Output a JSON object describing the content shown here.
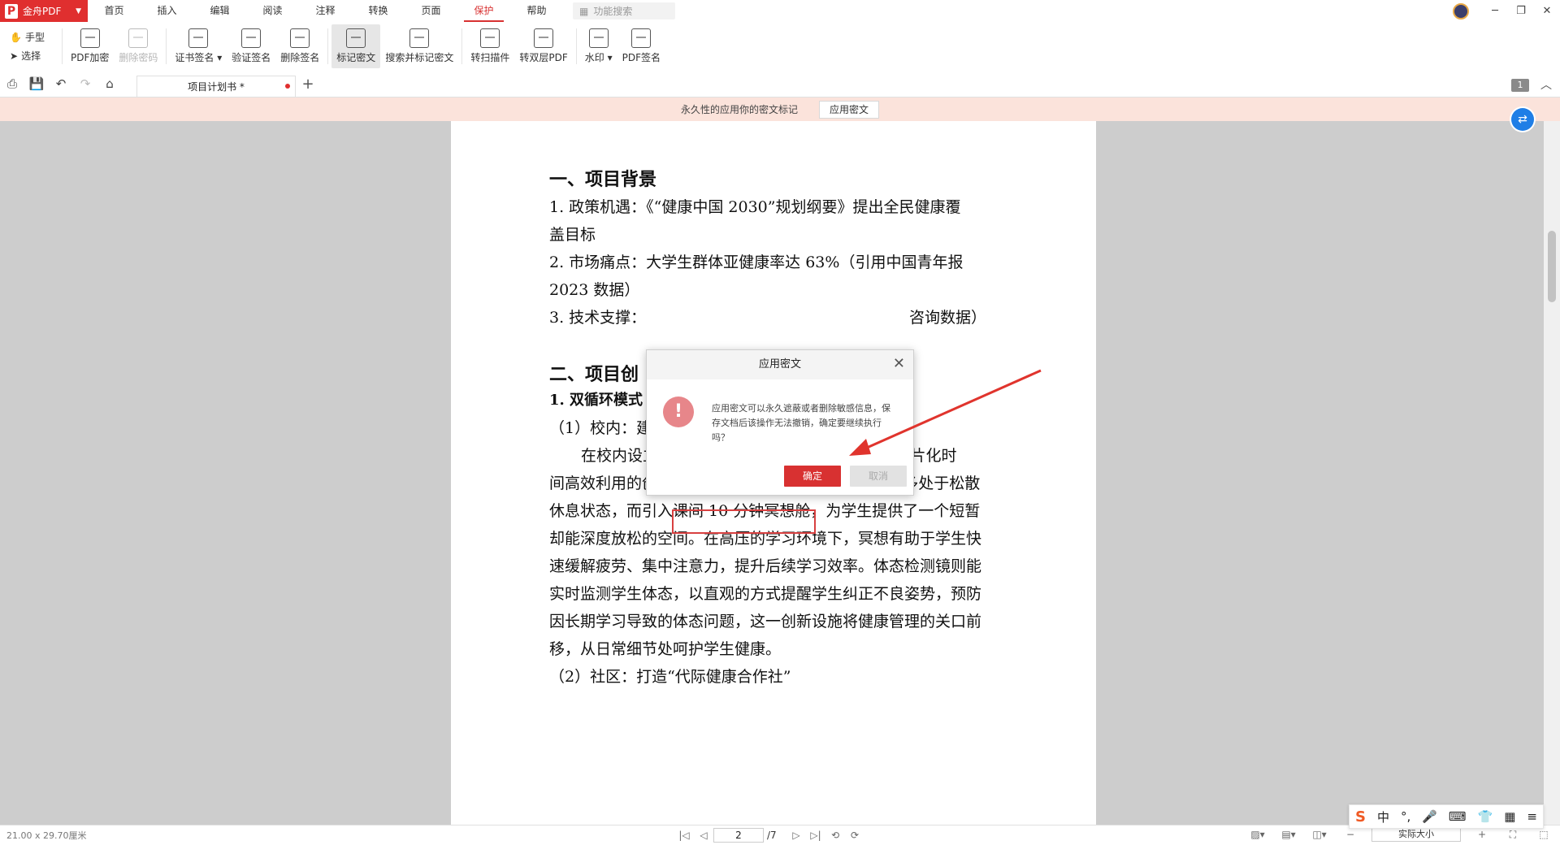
{
  "app": {
    "brand": "金舟PDF",
    "colors": {
      "accent": "#d83131",
      "notice_bg": "#fbe3db",
      "info_blue": "#1f7ee6"
    }
  },
  "menu": {
    "tabs": [
      "首页",
      "插入",
      "编辑",
      "阅读",
      "注释",
      "转换",
      "页面",
      "保护",
      "帮助"
    ],
    "active": "保护",
    "search_placeholder": "功能搜索"
  },
  "ribbon": {
    "hand": "手型",
    "select": "选择",
    "buttons": [
      {
        "label": "PDF加密",
        "icon": "lock-icon",
        "state": "normal"
      },
      {
        "label": "删除密码",
        "icon": "unlock-icon",
        "state": "disabled"
      },
      {
        "label": "证书签名",
        "icon": "certificate-sign-icon",
        "state": "dropdown"
      },
      {
        "label": "验证签名",
        "icon": "verify-sign-icon",
        "state": "normal"
      },
      {
        "label": "删除签名",
        "icon": "delete-sign-icon",
        "state": "normal"
      },
      {
        "label": "标记密文",
        "icon": "mark-redact-icon",
        "state": "selected"
      },
      {
        "label": "搜索并标记密文",
        "icon": "search-redact-icon",
        "state": "normal"
      },
      {
        "label": "转扫描件",
        "icon": "scan-icon",
        "state": "normal"
      },
      {
        "label": "转双层PDF",
        "icon": "dual-layer-icon",
        "state": "normal"
      },
      {
        "label": "水印",
        "icon": "watermark-icon",
        "state": "dropdown"
      },
      {
        "label": "PDF签名",
        "icon": "pdf-sign-icon",
        "state": "normal"
      }
    ]
  },
  "quickbar": {
    "doc_tab": "项目计划书 *",
    "page_badge": "1"
  },
  "notice": {
    "message": "永久性的应用你的密文标记",
    "apply_button": "应用密文"
  },
  "document": {
    "lines": [
      "一、项目背景",
      "1. 政策机遇：《“健康中国 2030”规划纲要》提出全民健康覆",
      "盖目标",
      "2. 市场痛点：大学生群体亚健康率达 63%（引用中国青年报",
      "2023 数据）",
      "3. 技术支撑：",
      "咨询数据）",
      "二、项目创",
      "1. 双循环模式",
      "（1）校内：建立“健康胶囊工作站”",
      "在校内设立 “健康胶囊工作站”，是对学生课间碎片化时",
      "间高效利用的创新尝试。传统的课间 10 分钟，学生多处于松散",
      "休息状态，而引入课间 10 分钟冥想舱，为学生提供了一个短暂",
      "却能深度放松的空间。在高压的学习环境下，冥想有助于学生快",
      "速缓解疲劳、集中注意力，提升后续学习效率。体态检测镜则能",
      "实时监测学生体态，以直观的方式提醒学生纠正不良姿势，预防",
      "因长期学习导致的体态问题，这一创新设施将健康管理的关口前",
      "移，从日常细节处呵护学生健康。",
      "（2）社区：打造“代际健康合作社”"
    ]
  },
  "dialog": {
    "title": "应用密文",
    "message": "应用密文可以永久遮蔽或者删除敏感信息，保存文档后该操作无法撤销，确定要继续执行吗？",
    "ok": "确定",
    "cancel": "取消"
  },
  "status": {
    "page_size": "21.00 x 29.70厘米",
    "current_page": "2",
    "total_pages": "/7",
    "zoom": "实际大小"
  },
  "ime": {
    "mode": "中"
  }
}
